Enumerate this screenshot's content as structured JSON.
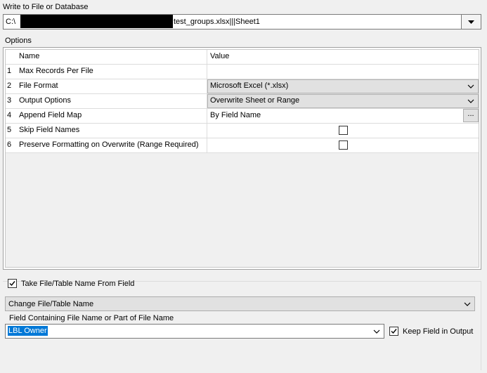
{
  "write_to": {
    "label": "Write to File or Database",
    "path_prefix": "C:\\",
    "path_suffix": "test_groups.xlsx|||Sheet1",
    "dropdown_icon": "triangle-down-icon"
  },
  "options": {
    "label": "Options",
    "columns": {
      "name": "Name",
      "value": "Value"
    },
    "rows": [
      {
        "num": "1",
        "name": "Max Records Per File",
        "value": ""
      },
      {
        "num": "2",
        "name": "File Format",
        "value": "Microsoft Excel (*.xlsx)"
      },
      {
        "num": "3",
        "name": "Output Options",
        "value": "Overwrite Sheet or Range"
      },
      {
        "num": "4",
        "name": "Append Field Map",
        "value": "By Field Name",
        "button": "..."
      },
      {
        "num": "5",
        "name": "Skip Field Names",
        "checked": false
      },
      {
        "num": "6",
        "name": "Preserve Formatting on Overwrite (Range Required)",
        "checked": false
      }
    ]
  },
  "take_from_field": {
    "label": "Take File/Table Name From Field",
    "checked": true,
    "mode": "Change File/Table Name",
    "field_label": "Field Containing File Name or Part of File Name",
    "field_value": "LBL Owner",
    "keep_field_label": "Keep Field in Output",
    "keep_field_checked": true
  }
}
